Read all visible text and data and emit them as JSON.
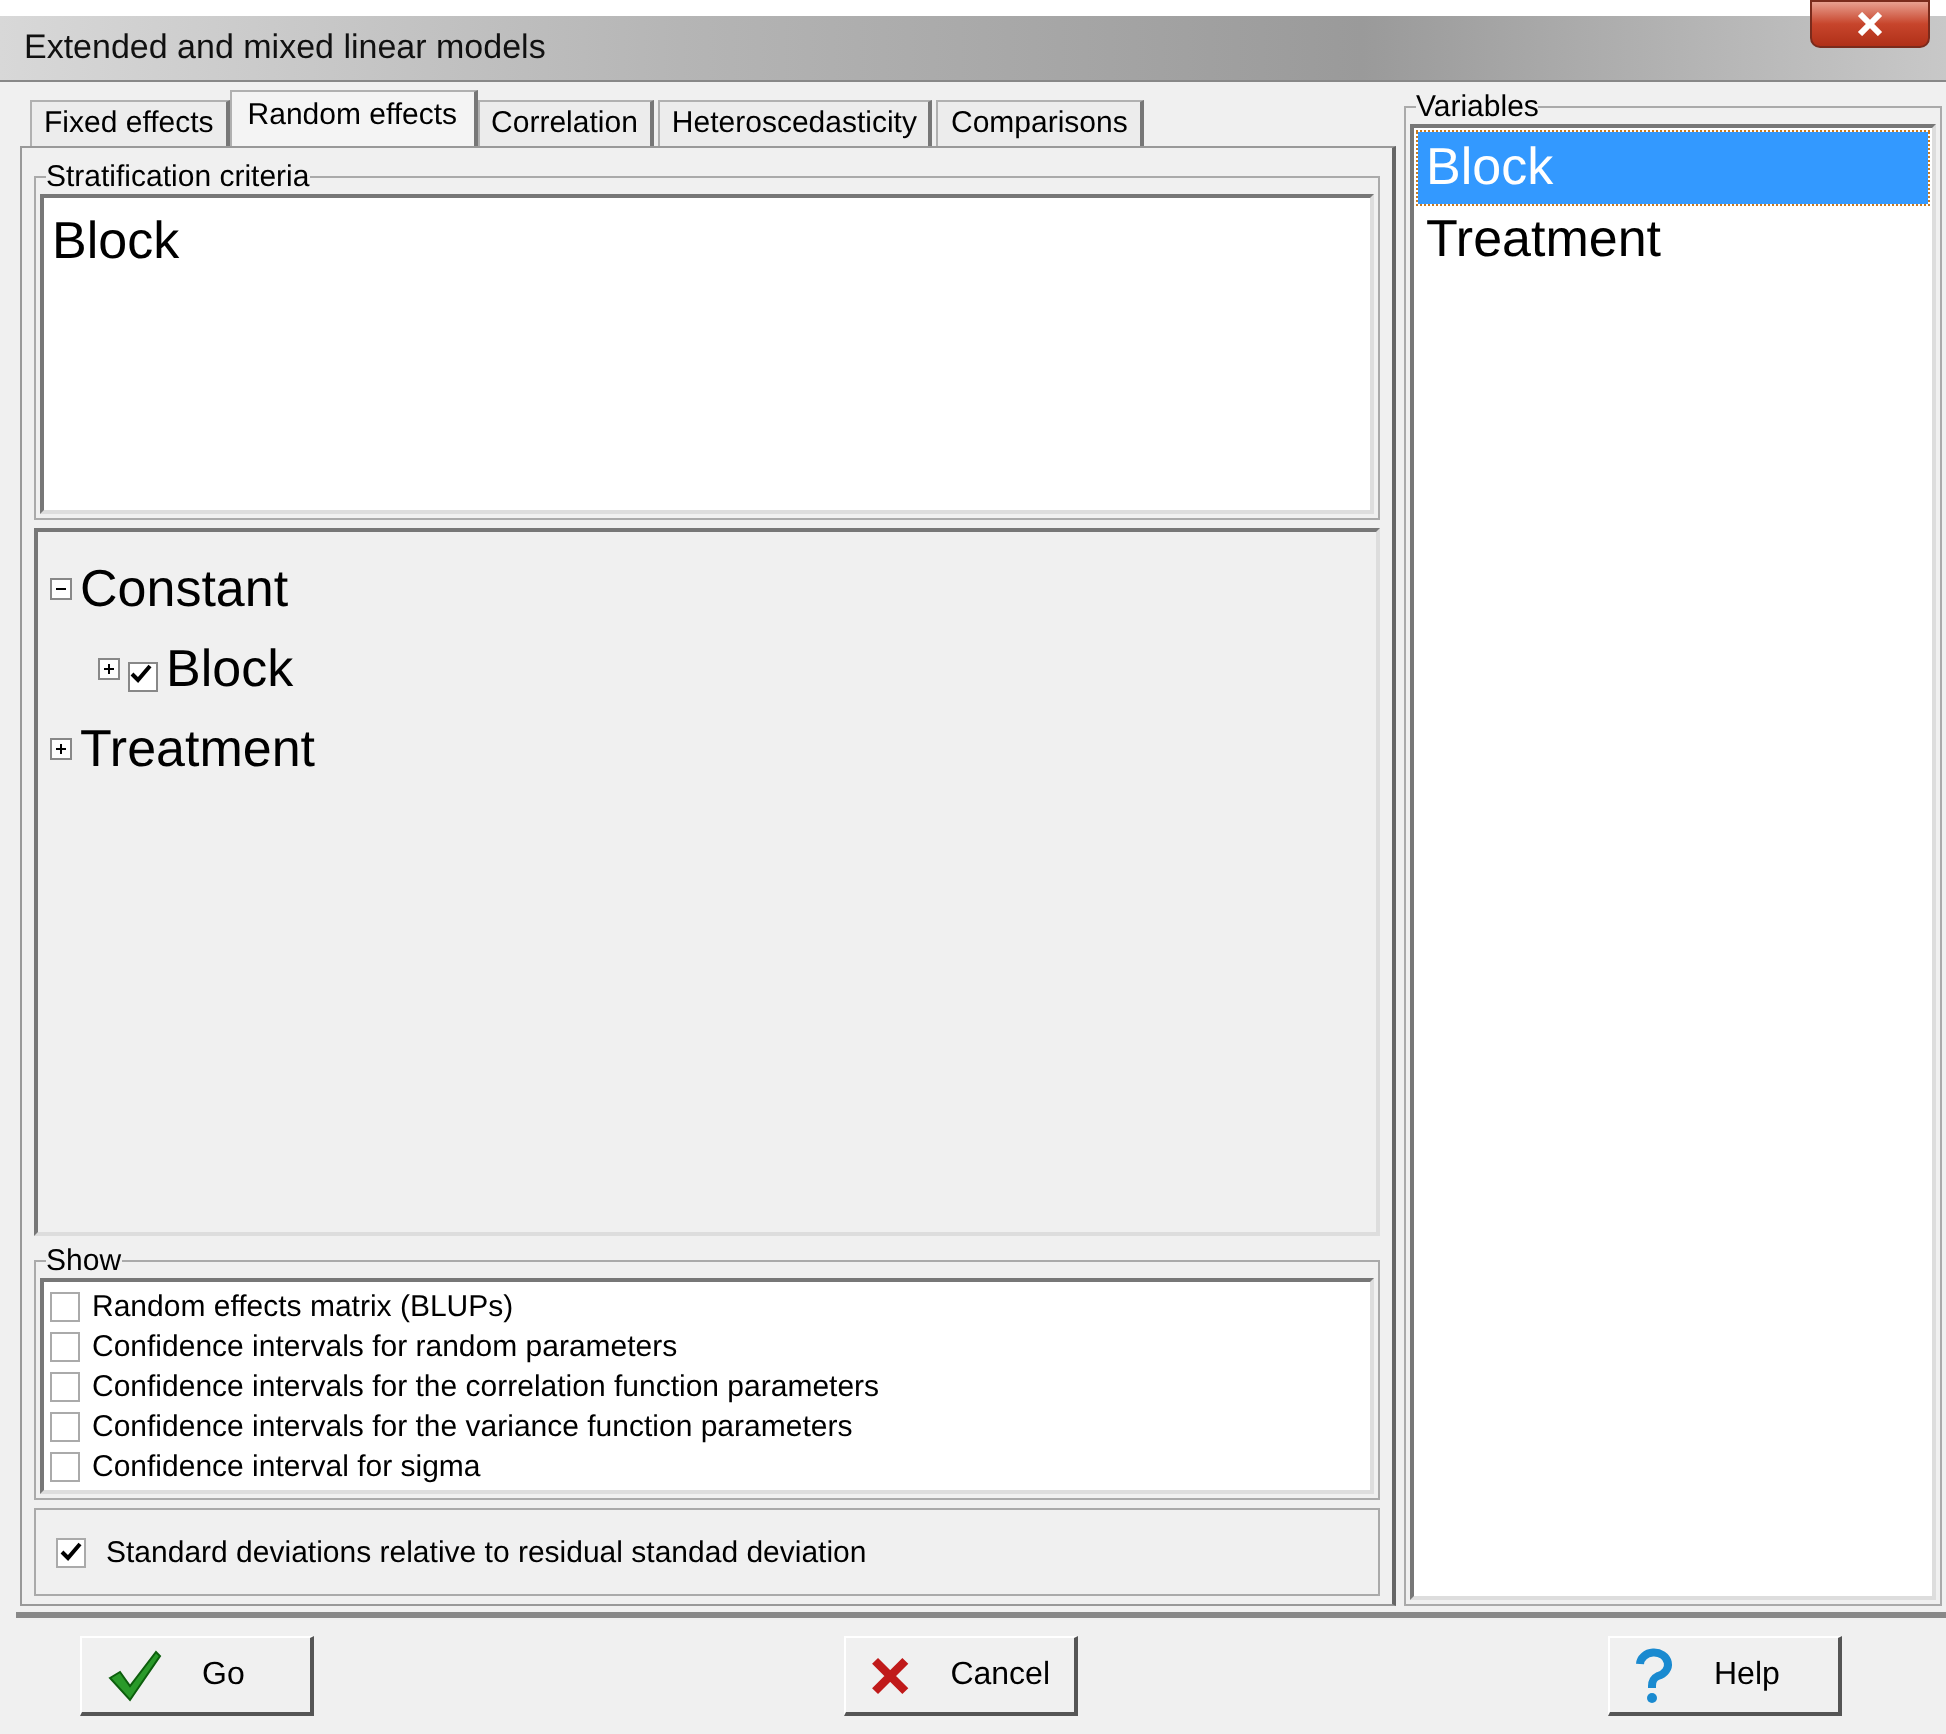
{
  "window": {
    "title": "Extended and mixed linear models"
  },
  "tabs": [
    {
      "label": "Fixed effects",
      "selected": false
    },
    {
      "label": "Random effects",
      "selected": true
    },
    {
      "label": "Correlation",
      "selected": false
    },
    {
      "label": "Heteroscedasticity",
      "selected": false
    },
    {
      "label": "Comparisons",
      "selected": false
    }
  ],
  "stratification": {
    "title": "Stratification criteria",
    "items": [
      "Block"
    ]
  },
  "tree": [
    {
      "label": "Constant",
      "expanded": true,
      "children": [
        {
          "label": "Block",
          "expanded": false,
          "checked": true
        }
      ]
    },
    {
      "label": "Treatment",
      "expanded": false
    }
  ],
  "show": {
    "title": "Show",
    "options": [
      {
        "label": "Random effects matrix (BLUPs)",
        "checked": false
      },
      {
        "label": "Confidence intervals for random parameters",
        "checked": false
      },
      {
        "label": "Confidence intervals for the correlation function parameters",
        "checked": false
      },
      {
        "label": "Confidence intervals for the variance function parameters",
        "checked": false
      },
      {
        "label": "Confidence interval for sigma",
        "checked": false
      }
    ]
  },
  "relative_sd": {
    "label": "Standard deviations relative to residual standad deviation",
    "checked": true
  },
  "variables": {
    "title": "Variables",
    "items": [
      {
        "label": "Block",
        "selected": true
      },
      {
        "label": "Treatment",
        "selected": false
      }
    ]
  },
  "buttons": [
    {
      "label": "Go",
      "kind": "ok"
    },
    {
      "label": "Cancel",
      "kind": "cancel"
    },
    {
      "label": "Help",
      "kind": "help"
    }
  ]
}
